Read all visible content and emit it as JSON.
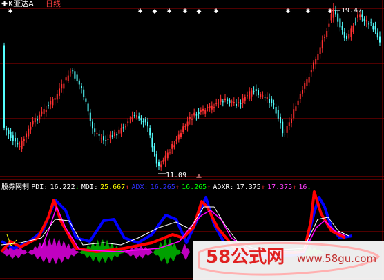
{
  "header": {
    "title": "K亚达A",
    "period": "日线"
  },
  "markers": {
    "labels": [
      "✚",
      "✱✱",
      "◆",
      "✱",
      "✱",
      "◆",
      "✚",
      "✚",
      "✚"
    ],
    "high_label": "19.47",
    "low_label": "11.09"
  },
  "indicator": {
    "name": "股券网制",
    "pdi_label": "PDI:",
    "pdi_value": "16.222",
    "pdi_arrow": "↓",
    "mdi_label": "MDI:",
    "mdi_value": "25.667",
    "mdi_arrow": "↑",
    "adx_label": "ADX:",
    "adx_value": "16.265",
    "adx_arrow": "↑",
    "adx2_value": "16.265",
    "adx2_arrow": "↑",
    "adxr_label": "ADXR:",
    "adxr_value": "17.375",
    "adxr_arrow": "↑",
    "adxr2_value": "17.375",
    "adxr2_arrow": "↑",
    "last_value": "16",
    "last_arrow": "↓"
  },
  "watermark": {
    "brand": "58公式网",
    "url": "www.58gu.com"
  },
  "colors": {
    "up": "#ff3030",
    "down": "#54ffff",
    "grid": "#a00000",
    "pdi": "#ffffff",
    "mdi": "#ffff00",
    "adx": "#ff00ff",
    "adxr": "#00ff00",
    "blue_line": "#0000ff",
    "red_line": "#ff0000",
    "magenta_fill": "#c000c0",
    "green_fill": "#00a000"
  }
}
